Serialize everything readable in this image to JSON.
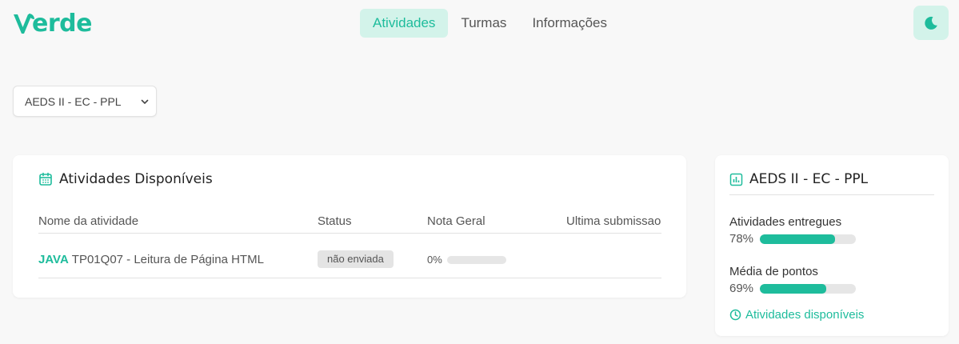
{
  "brand": {
    "name": "erde",
    "accent": "#1ebc9c",
    "icon": "verde-v-logo"
  },
  "nav": [
    {
      "label": "Atividades",
      "active": true
    },
    {
      "label": "Turmas",
      "active": false
    },
    {
      "label": "Informações",
      "active": false
    }
  ],
  "theme_toggle": {
    "icon": "moon-icon"
  },
  "class_select": {
    "value": "AEDS II - EC - PPL",
    "icon": "chevron-down-icon"
  },
  "activities": {
    "title": "Atividades Disponíveis",
    "icon": "calendar-icon",
    "columns": [
      "Nome da atividade",
      "Status",
      "Nota Geral",
      "Ultima submissao"
    ],
    "rows": [
      {
        "language": "JAVA",
        "name": "TP01Q07 - Leitura de Página HTML",
        "status": "não enviada",
        "grade": "0%",
        "grade_fraction": 0,
        "last_submission": ""
      }
    ]
  },
  "summary": {
    "title": "AEDS II - EC - PPL",
    "icon": "bar-chart-icon",
    "stats": [
      {
        "label": "Atividades entregues",
        "value": "78%",
        "fraction": 0.78
      },
      {
        "label": "Média de pontos",
        "value": "69%",
        "fraction": 0.69
      }
    ],
    "link": {
      "label": "Atividades disponíveis",
      "icon": "clock-icon"
    }
  }
}
